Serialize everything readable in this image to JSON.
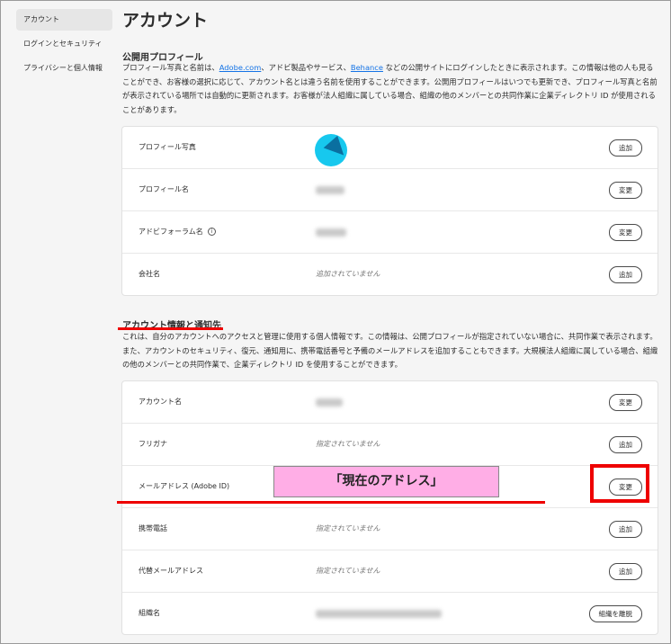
{
  "sidebar": {
    "items": [
      {
        "label": "アカウント"
      },
      {
        "label": "ログインとセキュリティ"
      },
      {
        "label": "プライバシーと個人情報"
      }
    ]
  },
  "title": "アカウント",
  "public_profile": {
    "heading": "公開用プロフィール",
    "desc_1": "プロフィール写真と名前は、",
    "link_1": "Adobe.com",
    "desc_2": "、アドビ製品やサービス、",
    "link_2": "Behance",
    "desc_3": " などの公開サイトにログインしたときに表示されます。この情報は他の人も見ることができ、お客様の選択に応じて、アカウント名とは違う名前を使用することができます。公開用プロフィールはいつでも更新でき、プロフィール写真と名前が表示されている場所では自動的に更新されます。お客様が法人組織に属している場合、組織の他のメンバーとの共同作業に企業ディレクトリ ID が使用されることがあります。",
    "rows": [
      {
        "label": "プロフィール写真",
        "button": "追加"
      },
      {
        "label": "プロフィール名",
        "button": "変更"
      },
      {
        "label": "アドビフォーラム名",
        "button": "変更"
      },
      {
        "label": "会社名",
        "value": "追加されていません",
        "button": "追加"
      }
    ]
  },
  "account_info": {
    "heading": "アカウント情報と通知先",
    "desc": "これは、自分のアカウントへのアクセスと管理に使用する個人情報です。この情報は、公開プロフィールが指定されていない場合に、共同作業で表示されます。また、アカウントのセキュリティ、復元、通知用に、携帯電話番号と予備のメールアドレスを追加することもできます。大規模法人組織に属している場合、組織の他のメンバーとの共同作業で、企業ディレクトリ ID を使用することができます。",
    "rows": [
      {
        "label": "アカウント名",
        "button": "変更"
      },
      {
        "label": "フリガナ",
        "value": "指定されていません",
        "button": "追加"
      },
      {
        "label": "メールアドレス (Adobe ID)",
        "button": "変更"
      },
      {
        "label": "携帯電話",
        "value": "指定されていません",
        "button": "追加"
      },
      {
        "label": "代替メールアドレス",
        "value": "指定されていません",
        "button": "追加"
      },
      {
        "label": "組織名",
        "button": "組織を離脱"
      }
    ]
  },
  "annotation": {
    "label": "「現在のアドレス」"
  },
  "info_icon": "i"
}
